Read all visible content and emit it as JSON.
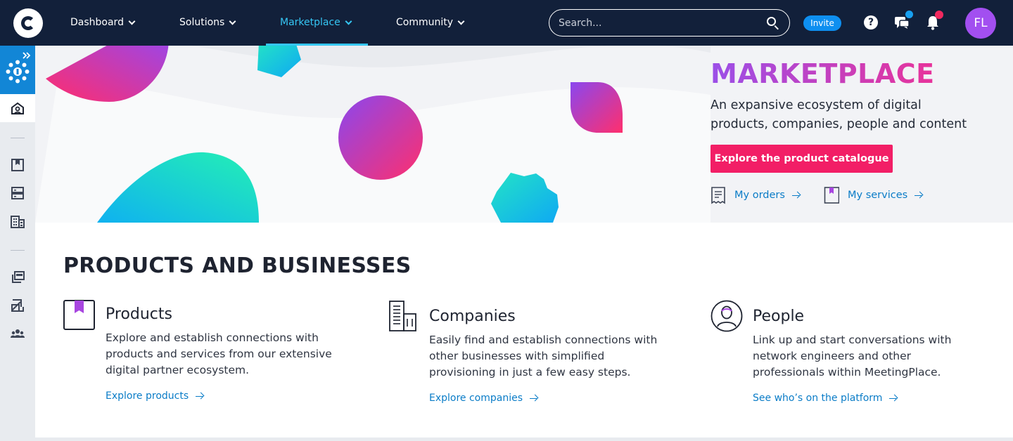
{
  "nav": {
    "items": [
      {
        "label": "Dashboard"
      },
      {
        "label": "Solutions"
      },
      {
        "label": "Marketplace"
      },
      {
        "label": "Community"
      }
    ],
    "search_placeholder": "Search...",
    "invite_label": "Invite",
    "help_glyph": "?",
    "avatar_initials": "FL"
  },
  "hero": {
    "title": "MARKETPLACE",
    "description": "An expansive ecosystem of digital products, companies, people and content",
    "cta_label": "Explore the product catalogue",
    "links": [
      {
        "label": "My orders",
        "icon": "receipt-icon"
      },
      {
        "label": "My services",
        "icon": "bookmark-icon"
      }
    ]
  },
  "section": {
    "title": "PRODUCTS AND BUSINESSES",
    "cards": [
      {
        "title": "Products",
        "text": "Explore and establish connections with products and services from our extensive digital partner ecosystem.",
        "link": "Explore products",
        "icon": "bookmark-icon"
      },
      {
        "title": "Companies",
        "text": "Easily find and establish connections with other businesses with simplified provisioning in just a few easy steps.",
        "link": "Explore companies",
        "icon": "building-icon"
      },
      {
        "title": "People",
        "text": "Link up and start conversations with network engineers and other professionals within MeetingPlace.",
        "link": "See who’s on the platform",
        "icon": "person-icon"
      }
    ]
  },
  "colors": {
    "nav_bg": "#12203a",
    "accent_cyan": "#35c6f4",
    "cta_pink": "#f21e66",
    "link_blue": "#0a7cc7",
    "avatar_purple": "#a24ff0"
  }
}
